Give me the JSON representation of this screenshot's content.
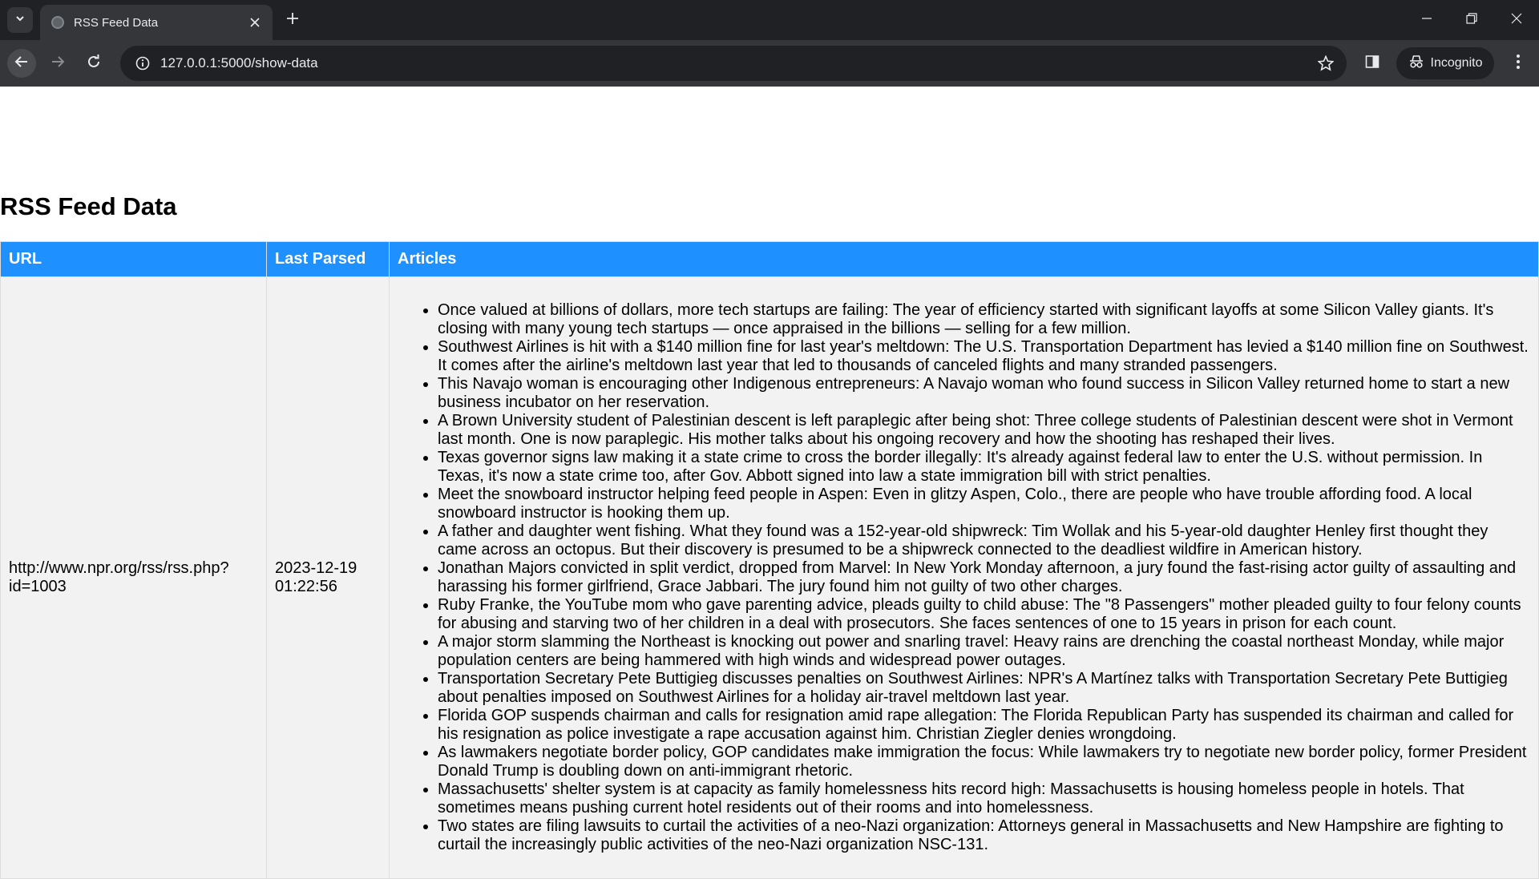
{
  "browser": {
    "tab_title": "RSS Feed Data",
    "url": "127.0.0.1:5000/show-data",
    "incognito_label": "Incognito",
    "icons": [
      "tab-search-icon",
      "globe-icon",
      "close-icon",
      "plus-icon",
      "minimize-icon",
      "restore-icon",
      "close-icon",
      "back-arrow-icon",
      "forward-arrow-icon",
      "reload-icon",
      "info-icon",
      "star-icon",
      "side-panel-icon",
      "incognito-icon",
      "more-vert-icon"
    ]
  },
  "page": {
    "title": "RSS Feed Data",
    "table": {
      "headers": [
        "URL",
        "Last Parsed",
        "Articles"
      ],
      "rows": [
        {
          "url": "http://www.npr.org/rss/rss.php?id=1003",
          "last_parsed": "2023-12-19 01:22:56",
          "articles": [
            "Once valued at billions of dollars, more tech startups are failing: The year of efficiency started with significant layoffs at some Silicon Valley giants. It's closing with many young tech startups — once appraised in the billions — selling for a few million.",
            "Southwest Airlines is hit with a $140 million fine for last year's meltdown: The U.S. Transportation Department has levied a $140 million fine on Southwest. It comes after the airline's meltdown last year that led to thousands of canceled flights and many stranded passengers.",
            "This Navajo woman is encouraging other Indigenous entrepreneurs: A Navajo woman who found success in Silicon Valley returned home to start a new business incubator on her reservation.",
            "A Brown University student of Palestinian descent is left paraplegic after being shot: Three college students of Palestinian descent were shot in Vermont last month. One is now paraplegic. His mother talks about his ongoing recovery and how the shooting has reshaped their lives.",
            "Texas governor signs law making it a state crime to cross the border illegally: It's already against federal law to enter the U.S. without permission. In Texas, it's now a state crime too, after Gov. Abbott signed into law a state immigration bill with strict penalties.",
            "Meet the snowboard instructor helping feed people in Aspen: Even in glitzy Aspen, Colo., there are people who have trouble affording food. A local snowboard instructor is hooking them up.",
            "A father and daughter went fishing. What they found was a 152-year-old shipwreck: Tim Wollak and his 5-year-old daughter Henley first thought they came across an octopus. But their discovery is presumed to be a shipwreck connected to the deadliest wildfire in American history.",
            "Jonathan Majors convicted in split verdict, dropped from Marvel: In New York Monday afternoon, a jury found the fast-rising actor guilty of assaulting and harassing his former girlfriend, Grace Jabbari. The jury found him not guilty of two other charges.",
            "Ruby Franke, the YouTube mom who gave parenting advice, pleads guilty to child abuse: The \"8 Passengers\" mother pleaded guilty to four felony counts for abusing and starving two of her children in a deal with prosecutors. She faces sentences of one to 15 years in prison for each count.",
            "A major storm slamming the Northeast is knocking out power and snarling travel: Heavy rains are drenching the coastal northeast Monday, while major population centers are being hammered with high winds and widespread power outages.",
            "Transportation Secretary Pete Buttigieg discusses penalties on Southwest Airlines: NPR's A Martínez talks with Transportation Secretary Pete Buttigieg about penalties imposed on Southwest Airlines for a holiday air-travel meltdown last year.",
            "Florida GOP suspends chairman and calls for resignation amid rape allegation: The Florida Republican Party has suspended its chairman and called for his resignation as police investigate a rape accusation against him. Christian Ziegler denies wrongdoing.",
            "As lawmakers negotiate border policy, GOP candidates make immigration the focus: While lawmakers try to negotiate new border policy, former President Donald Trump is doubling down on anti-immigrant rhetoric.",
            "Massachusetts' shelter system is at capacity as family homelessness hits record high: Massachusetts is housing homeless people in hotels. That sometimes means pushing current hotel residents out of their rooms and into homelessness.",
            "Two states are filing lawsuits to curtail the activities of a neo-Nazi organization: Attorneys general in Massachusetts and New Hampshire are fighting to curtail the increasingly public activities of the neo-Nazi organization NSC-131."
          ]
        }
      ]
    }
  },
  "colors": {
    "header_bg": "#1e90ff",
    "cell_bg": "#f2f2f2",
    "chrome_bg": "#202124",
    "toolbar_bg": "#35363a"
  }
}
